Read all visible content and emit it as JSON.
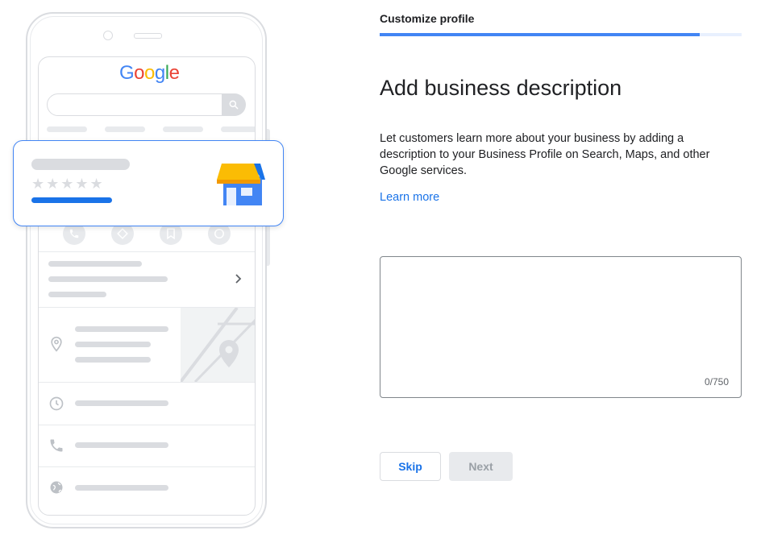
{
  "step": {
    "label": "Customize profile",
    "progress": 0.885
  },
  "heading": "Add business description",
  "description": "Let customers learn more about your business by adding a description to your Business Profile on Search, Maps, and other Google services.",
  "learn_more": "Learn more",
  "description_field": {
    "value": "",
    "counter": "0/750"
  },
  "buttons": {
    "skip": "Skip",
    "next": "Next"
  },
  "illustration": {
    "logo": [
      "G",
      "o",
      "o",
      "g",
      "l",
      "e"
    ],
    "stars": "★★★★★"
  },
  "colors": {
    "accent": "#1a73e8",
    "progress": "#4285f4",
    "disabled_bg": "#e8eaed",
    "disabled_text": "#9aa0a6",
    "store_awning": "#fbbc04",
    "store_body": "#4285f4"
  }
}
